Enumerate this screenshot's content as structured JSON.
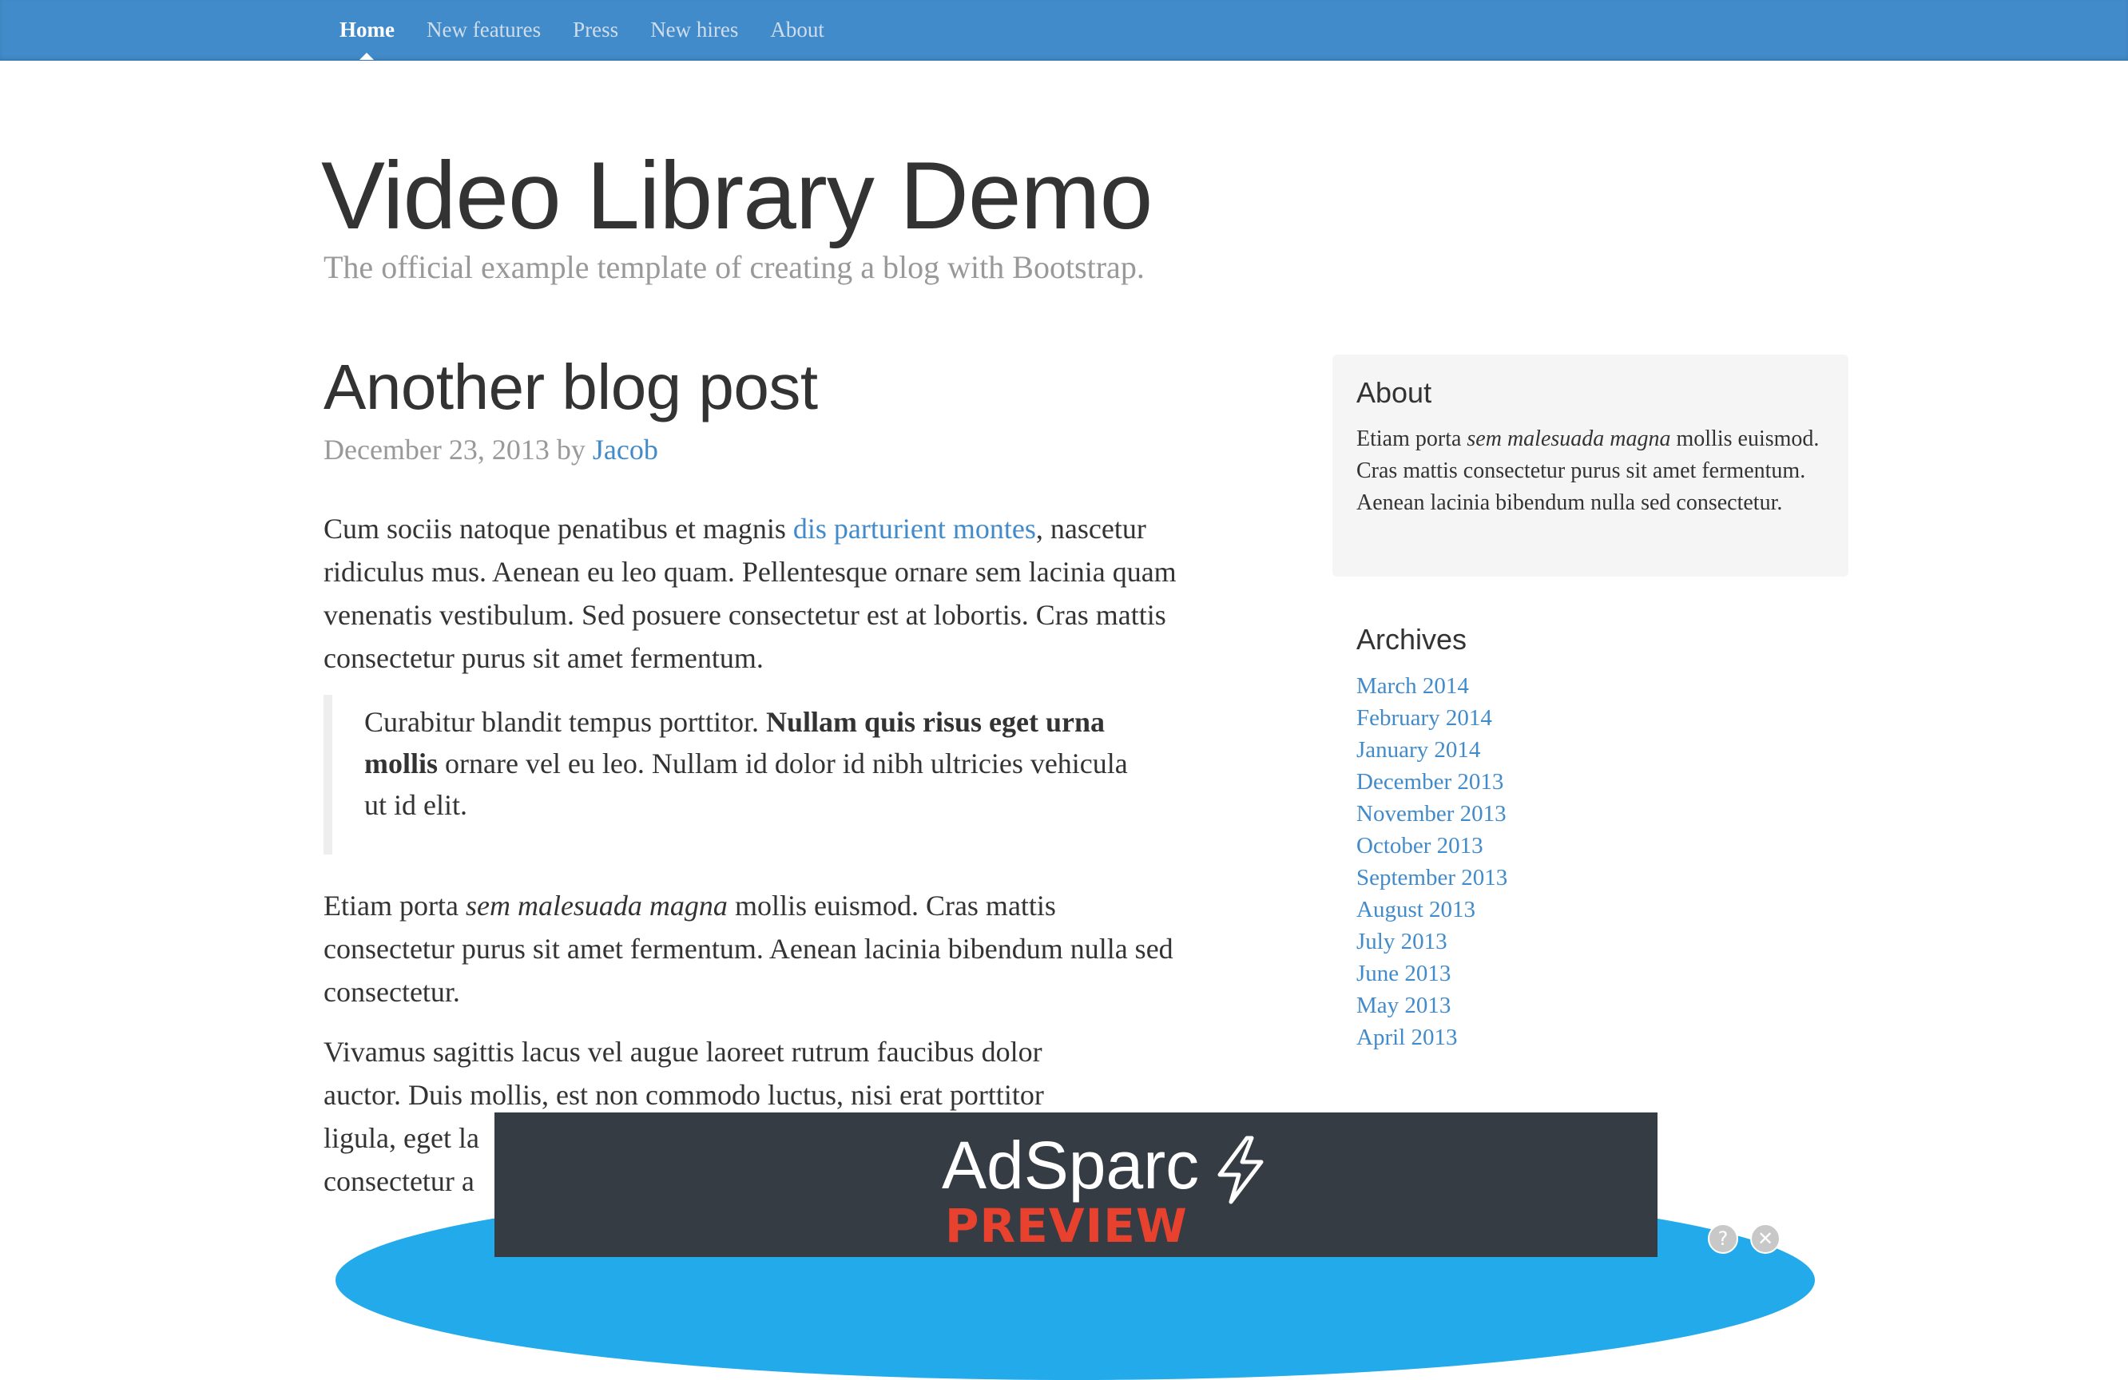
{
  "nav": {
    "items": [
      {
        "label": "Home",
        "active": true
      },
      {
        "label": "New features",
        "active": false
      },
      {
        "label": "Press",
        "active": false
      },
      {
        "label": "New hires",
        "active": false
      },
      {
        "label": "About",
        "active": false
      }
    ]
  },
  "header": {
    "title": "Video Library Demo",
    "description": "The official example template of creating a blog with Bootstrap."
  },
  "post": {
    "title": "Another blog post",
    "date": "December 23, 2013",
    "by": "by",
    "author": "Jacob",
    "p1": {
      "before_link": "Cum sociis natoque penatibus et magnis ",
      "link": "dis parturient montes",
      "after_link": ", nascetur ridiculus mus. Aenean eu leo quam. Pellentesque ornare sem lacinia quam venenatis vestibulum. Sed posuere consectetur est at lobortis. Cras mattis consectetur purus sit amet fermentum."
    },
    "quote": {
      "before_bold": "Curabitur blandit tempus porttitor. ",
      "bold": "Nullam quis risus eget urna mollis",
      "after_bold": " ornare vel eu leo. Nullam id dolor id nibh ultricies vehicula ut id elit."
    },
    "p2": {
      "before_em": "Etiam porta ",
      "em": "sem malesuada magna",
      "after_em": " mollis euismod. Cras mattis consectetur purus sit amet fermentum. Aenean lacinia bibendum nulla sed consectetur."
    },
    "p3": {
      "line1": "Vivamus sagittis lacus vel augue laoreet rutrum faucibus dolor",
      "line2": "auctor. Duis mollis, est non commodo luctus, nisi erat porttitor",
      "line3": "ligula, eget la",
      "line4": "consectetur a"
    }
  },
  "sidebar": {
    "about": {
      "heading": "About",
      "before_em": "Etiam porta ",
      "em": "sem malesuada magna",
      "after_em": " mollis euismod. Cras mattis consectetur purus sit amet fermentum. Aenean lacinia bibendum nulla sed consectetur."
    },
    "archives": {
      "heading": "Archives",
      "items": [
        "March 2014",
        "February 2014",
        "January 2014",
        "December 2013",
        "November 2013",
        "October 2013",
        "September 2013",
        "August 2013",
        "July 2013",
        "June 2013",
        "May 2013",
        "April 2013"
      ]
    }
  },
  "ad": {
    "brand": "AdSparc",
    "preview_label": "PREVIEW",
    "help_label": "?",
    "close_label": "✕",
    "brand_icon": "lightning-bolt-icon",
    "colors": {
      "panel": "#363c44",
      "ellipse": "#22aaea",
      "preview": "#e8412d"
    }
  },
  "colors": {
    "navbar": "#428bca",
    "link": "#428bca",
    "muted": "#999999",
    "text": "#333333"
  }
}
